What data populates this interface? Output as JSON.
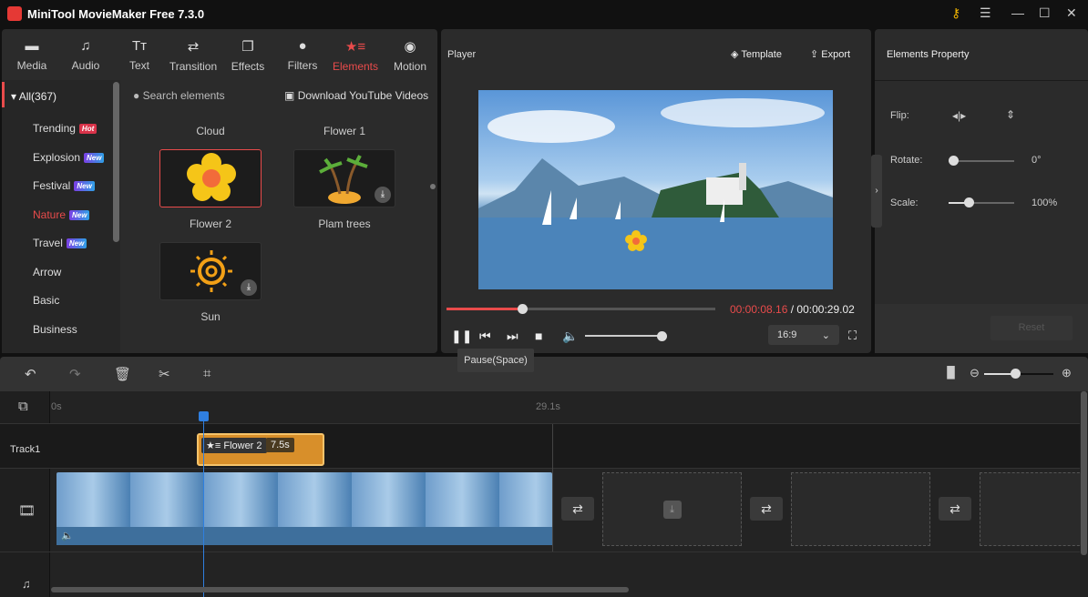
{
  "app": {
    "title": "MiniTool MovieMaker Free 7.3.0",
    "controls": [
      "key-icon",
      "menu-icon",
      "minimize-icon",
      "maximize-icon",
      "close-icon"
    ]
  },
  "nav": [
    {
      "label": "Media",
      "icon": "folder-icon"
    },
    {
      "label": "Audio",
      "icon": "music-icon"
    },
    {
      "label": "Text",
      "icon": "text-icon"
    },
    {
      "label": "Transition",
      "icon": "transition-icon"
    },
    {
      "label": "Effects",
      "icon": "effects-icon"
    },
    {
      "label": "Filters",
      "icon": "filters-icon"
    },
    {
      "label": "Elements",
      "icon": "elements-icon",
      "active": true
    },
    {
      "label": "Motion",
      "icon": "motion-icon"
    }
  ],
  "accent": "#e94b4b",
  "categories": {
    "all": "All(367)",
    "items": [
      {
        "label": "Trending",
        "badge": "Hot"
      },
      {
        "label": "Explosion",
        "badge": "New"
      },
      {
        "label": "Festival",
        "badge": "New"
      },
      {
        "label": "Nature",
        "badge": "New",
        "active": true
      },
      {
        "label": "Travel",
        "badge": "New"
      },
      {
        "label": "Arrow"
      },
      {
        "label": "Basic"
      },
      {
        "label": "Business"
      }
    ]
  },
  "search": {
    "placeholder": "Search elements",
    "download": "Download YouTube Videos"
  },
  "elements": {
    "top_labels": [
      "Cloud",
      "Flower 1"
    ],
    "items": [
      {
        "label": "Flower 2",
        "selected": true
      },
      {
        "label": "Plam trees",
        "download": true
      },
      {
        "label": "Sun",
        "download": true
      }
    ]
  },
  "player": {
    "title": "Player",
    "template": "Template",
    "export": "Export",
    "current": "00:00:08.16",
    "separator": " / ",
    "total": "00:00:29.02",
    "progress": 0.28,
    "volume": 1.0,
    "aspect": "16:9",
    "tooltip": "Pause(Space)"
  },
  "properties": {
    "title": "Elements Property",
    "flip": "Flip:",
    "rotate": "Rotate:",
    "rotate_value": "0°",
    "scale": "Scale:",
    "scale_value": "100%",
    "reset": "Reset"
  },
  "timeline": {
    "ruler_start": "0s",
    "ruler_end": "29.1s",
    "track1": "Track1",
    "clip": {
      "label": "Flower 2",
      "duration": "7.5s"
    }
  }
}
